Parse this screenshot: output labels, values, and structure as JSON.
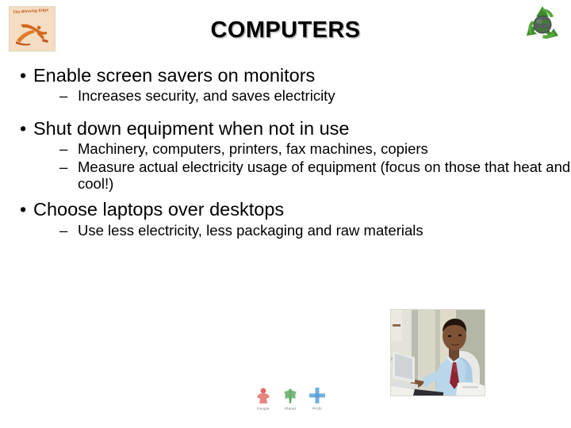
{
  "slide": {
    "title": "COMPUTERS",
    "logo": {
      "name": "the-winning-edge-logo",
      "text": "The Winning Edge",
      "badge_color": "#f4ddc2",
      "figure_color": "#d2691e"
    },
    "recycle": {
      "name": "recycle-globe-icon",
      "color": "#3f8b2e",
      "globe_color": "#44604a"
    },
    "bullets": [
      {
        "level1": "Enable screen savers on monitors",
        "level2": [
          "Increases security, and saves electricity"
        ]
      },
      {
        "level1": "Shut down equipment when not in use",
        "level2": [
          "Machinery, computers, printers, fax machines, copiers",
          "Measure actual electricity usage of equipment (focus on those that heat and cool!)"
        ]
      },
      {
        "level1": "Choose laptops over desktops",
        "level2": [
          "Use less electricity, less packaging and raw materials"
        ]
      }
    ],
    "bullet_marker_l1": "•",
    "bullet_marker_l2": "–",
    "photo": {
      "name": "man-with-laptop-photo",
      "alt": "Man in light blue shirt and red tie working on a laptop"
    },
    "triple_bottom_line": [
      {
        "label": "People",
        "icon": "person-icon",
        "color": "#e8837e"
      },
      {
        "label": "Planet",
        "icon": "leaf-icon",
        "color": "#74b87a"
      },
      {
        "label": "Profit",
        "icon": "cross-icon",
        "color": "#6fb0dd"
      }
    ]
  }
}
